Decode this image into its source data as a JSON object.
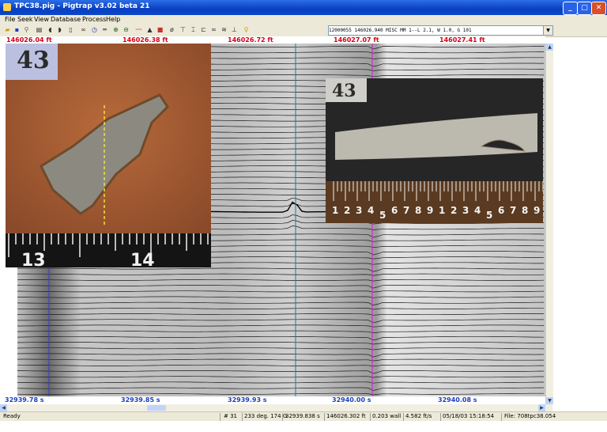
{
  "window": {
    "title": "TPC38.pig - Pigtrap v3.02 beta 21",
    "min": "_",
    "max": "□",
    "close": "✕"
  },
  "menu": [
    "File",
    "Seek",
    "View",
    "Database",
    "Process",
    "Help"
  ],
  "toolbar_icons": [
    "open-icon",
    "save-icon",
    "find-icon",
    "print-icon",
    "back-icon",
    "forward-icon",
    "document-icon",
    "binoculars-icon",
    "clock-icon",
    "ruler-icon",
    "zoom-in-icon",
    "zoom-out-icon",
    "wave-icon",
    "triangle-icon",
    "color-scale-icon",
    "diameter-icon",
    "measure-icon",
    "measure2-icon",
    "measure3-icon",
    "wave2-icon",
    "wave3-icon",
    "marker-icon",
    "help-icon"
  ],
  "combo_text": "12000055  146026.940 MISC        MM 1--L 2.1, W 1.0, G 101",
  "distances": [
    "146026.04 ft",
    "146026.38 ft",
    "146026.72 ft",
    "146027.07 ft",
    "146027.41 ft"
  ],
  "times": [
    "32939.78 s",
    "32939.85 s",
    "32939.93 s",
    "32940.00 s",
    "32940.08 s"
  ],
  "status": {
    "ready": "Ready",
    "sensor": "# 31",
    "angle": "233 deg. 174 G",
    "time": "32939.838 s",
    "distance": "146026.302 ft",
    "wall": "0.203 wall",
    "speed": "4.582 ft/s",
    "date": "05/18/03 15:18:54",
    "file": "File: 708tpc38.054"
  },
  "photo_labels": {
    "left": "43",
    "right": "43"
  },
  "ruler_numbers_right": [
    "1",
    "2",
    "3",
    "4",
    "5",
    "6",
    "7",
    "8",
    "9",
    "1",
    "2",
    "3",
    "4",
    "5",
    "6",
    "7",
    "8",
    "9"
  ],
  "ruler_numbers_left": [
    "13",
    "14"
  ],
  "colors": {
    "distance": "#d2001a",
    "time": "#1a3fc0",
    "cursor_pink": "#cc2cc8",
    "cursor_blue": "#3a3ae0",
    "titlebar": "#0a3fc2"
  }
}
